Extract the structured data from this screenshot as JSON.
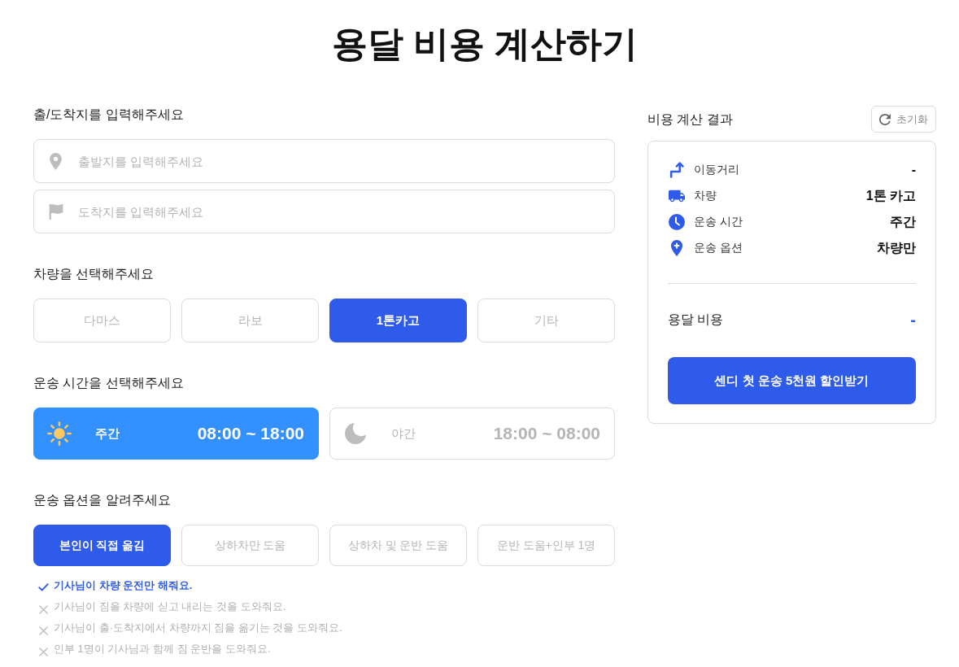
{
  "title": "용달 비용 계산하기",
  "locations": {
    "heading": "출/도착지를 입력해주세요",
    "fields": [
      {
        "kind": "origin",
        "placeholder": "출발지를 입력해주세요"
      },
      {
        "kind": "destination",
        "placeholder": "도착지를 입력해주세요"
      }
    ]
  },
  "vehicle": {
    "heading": "차량을 선택해주세요",
    "options": [
      {
        "label": "다마스",
        "selected": false
      },
      {
        "label": "라보",
        "selected": false
      },
      {
        "label": "1톤카고",
        "selected": true
      },
      {
        "label": "기타",
        "selected": false
      }
    ]
  },
  "time": {
    "heading": "운송 시간을 선택해주세요",
    "options": [
      {
        "kind": "day",
        "label": "주간",
        "hours": "08:00 ~ 18:00",
        "selected": true
      },
      {
        "kind": "night",
        "label": "야간",
        "hours": "18:00 ~ 08:00",
        "selected": false
      }
    ]
  },
  "service": {
    "heading": "운송 옵션을 알려주세요",
    "options": [
      {
        "label": "본인이 직접 옮김",
        "selected": true
      },
      {
        "label": "상하차만 도움",
        "selected": false
      },
      {
        "label": "상하차 및 운반 도움",
        "selected": false
      },
      {
        "label": "운반 도움+인부 1명",
        "selected": false
      }
    ],
    "notes": [
      {
        "text": "기사님이 차량 운전만 해줘요.",
        "included": true
      },
      {
        "text": "기사님이 짐을 차량에 싣고 내리는 것을 도와줘요.",
        "included": false
      },
      {
        "text": "기사님이 출·도착지에서 차량까지 짐을 옮기는 것을 도와줘요.",
        "included": false
      },
      {
        "text": "인부 1명이 기사님과 함께 짐 운반을 도와줘요.",
        "included": false
      }
    ]
  },
  "result": {
    "heading": "비용 계산 결과",
    "reset_button": "초기화",
    "rows": [
      {
        "kind": "distance",
        "label": "이동거리",
        "value": "-"
      },
      {
        "kind": "vehicle",
        "label": "차량",
        "value": "1톤 카고"
      },
      {
        "kind": "time",
        "label": "운송 시간",
        "value": "주간"
      },
      {
        "kind": "option",
        "label": "운송 옵션",
        "value": "차량만"
      }
    ],
    "total_label": "용달 비용",
    "total_value": "-",
    "cta_button": "센디 첫 운송 5천원 할인받기"
  }
}
